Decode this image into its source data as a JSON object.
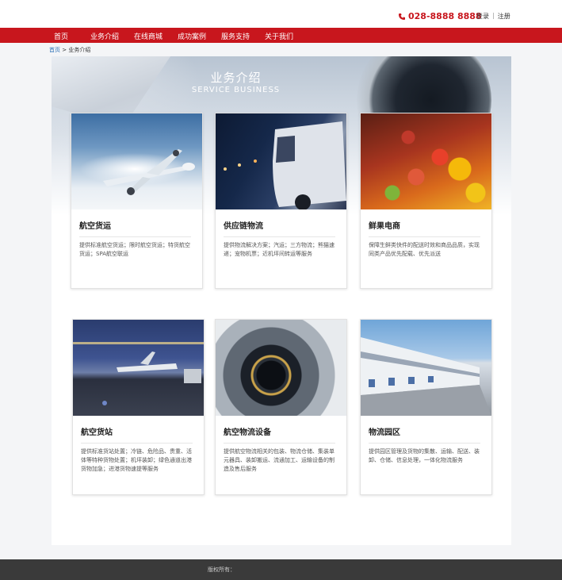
{
  "header": {
    "phone": "028-8888 8888",
    "phone_icon": "phone-icon",
    "login": "登录",
    "separator": "|",
    "register": "注册"
  },
  "nav": {
    "items": [
      {
        "label": "首页"
      },
      {
        "label": "业务介绍"
      },
      {
        "label": "在线商城"
      },
      {
        "label": "成功案例"
      },
      {
        "label": "服务支持"
      },
      {
        "label": "关于我们"
      }
    ]
  },
  "breadcrumb": {
    "home": "首页",
    "separator": ">",
    "current": "业务介绍"
  },
  "hero": {
    "title": "业务介绍",
    "subtitle": "SERVICE  BUSINESS"
  },
  "cards": [
    {
      "title": "航空货运",
      "desc": "提供标准航空货运；限时航空货运；特货航空货运；SPA航空联运"
    },
    {
      "title": "供应链物流",
      "desc": "提供物流解决方案；汽运；三方物流；熊猫速递；宠物机票；近机坪间转运等服务"
    },
    {
      "title": "鲜果电商",
      "desc": "保障生鲜类快件的配送时效和商品品质，实现同类产品优先配载、优先派送"
    },
    {
      "title": "航空货站",
      "desc": "提供标准货站处置；冷链、危险品、贵重、活体等特种货物处置；机坪装卸；绿色通道出港货物加急；进港货物速提等服务"
    },
    {
      "title": "航空物流设备",
      "desc": "提供航空物流相关的包装、物流仓储、集装单元器具、装卸搬运、流通加工、运输设备的制造及售后服务"
    },
    {
      "title": "物流园区",
      "desc": "提供园区管理及货物的集散、运输、配送、装卸、仓储、信息处理，一体化物流服务"
    }
  ],
  "footer": {
    "copyright": "版权所有："
  },
  "colors": {
    "brand_red": "#c8161d",
    "footer_bg": "#3a3a3a",
    "link_blue": "#2a6fb5"
  }
}
